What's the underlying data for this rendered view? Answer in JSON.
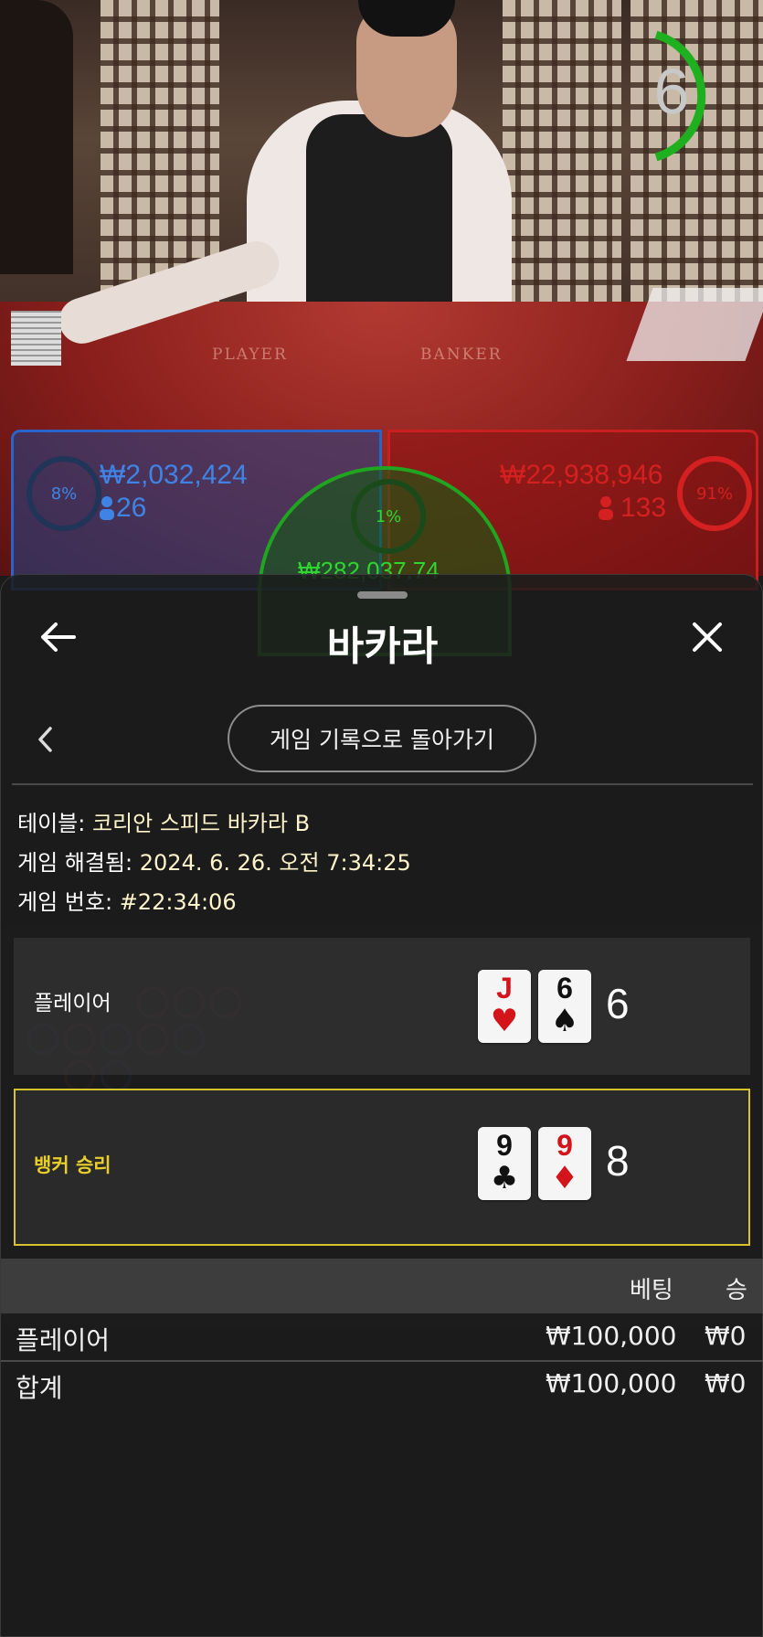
{
  "game": {
    "timer_value": "6",
    "table_labels": {
      "player": "PLAYER",
      "banker": "BANKER"
    },
    "player_panel": {
      "percent": "8%",
      "amount": "₩2,032,424",
      "users": "26"
    },
    "banker_panel": {
      "percent": "91%",
      "amount": "₩22,938,946",
      "users": "133"
    },
    "tie_panel": {
      "percent": "1%",
      "amount": "₩282,037.74"
    },
    "colors": {
      "player": "#2a63c9",
      "banker": "#c82020",
      "tie": "#1fa51f",
      "highlight": "#d7c22a"
    }
  },
  "sheet": {
    "title": "바카라",
    "back_icon": "arrow-left-icon",
    "close_icon": "close-icon",
    "history_button": "게임 기록으로 돌아가기",
    "info": {
      "table_label": "테이블:",
      "table_value": "코리안 스피드 바카라 B",
      "resolved_label": "게임 해결됨:",
      "resolved_value": "2024. 6. 26. 오전 7:34:25",
      "number_label": "게임 번호:",
      "number_value": "#22:34:06"
    },
    "hands": [
      {
        "label": "플레이어",
        "score": "6",
        "cards": [
          {
            "rank": "J",
            "suit": "♥",
            "color": "red"
          },
          {
            "rank": "6",
            "suit": "♠",
            "color": "black"
          }
        ]
      },
      {
        "label": "뱅커 승리",
        "score": "8",
        "cards": [
          {
            "rank": "9",
            "suit": "♣",
            "color": "black"
          },
          {
            "rank": "9",
            "suit": "♦",
            "color": "red"
          }
        ]
      }
    ],
    "bets": {
      "header_bet": "베팅",
      "header_win": "승",
      "rows": [
        {
          "name": "플레이어",
          "bet": "₩100,000",
          "win": "₩0"
        },
        {
          "name": "합계",
          "bet": "₩100,000",
          "win": "₩0"
        }
      ]
    }
  }
}
